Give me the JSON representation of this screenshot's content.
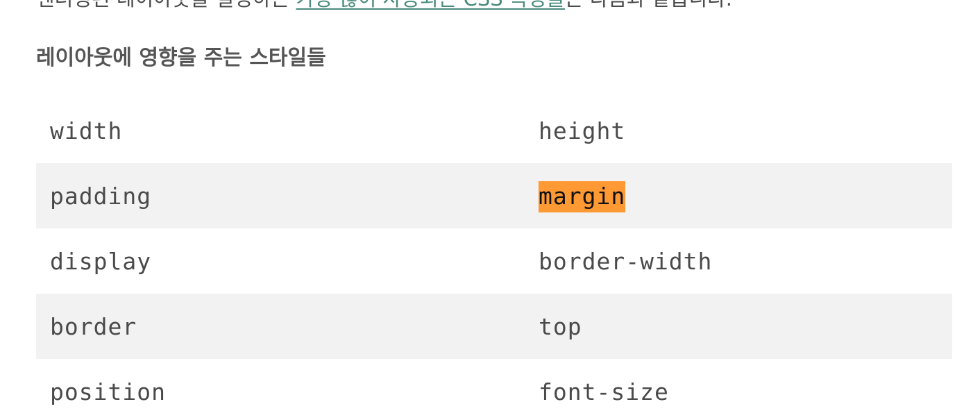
{
  "intro": {
    "before": "렌더링된 레이아웃을 결정하는 ",
    "link": "가장 많이 사용되는 CSS 속성들",
    "after": "은 다음과 같습니다."
  },
  "heading": "레이아웃에 영향을 주는 스타일들",
  "properties": [
    [
      "width",
      "height"
    ],
    [
      "padding",
      "margin"
    ],
    [
      "display",
      "border-width"
    ],
    [
      "border",
      "top"
    ],
    [
      "position",
      "font-size"
    ]
  ],
  "highlighted_property": "margin",
  "colors": {
    "link": "#4a8a7c",
    "row_shade": "#f2f2f2",
    "highlight": "#ff9933"
  }
}
